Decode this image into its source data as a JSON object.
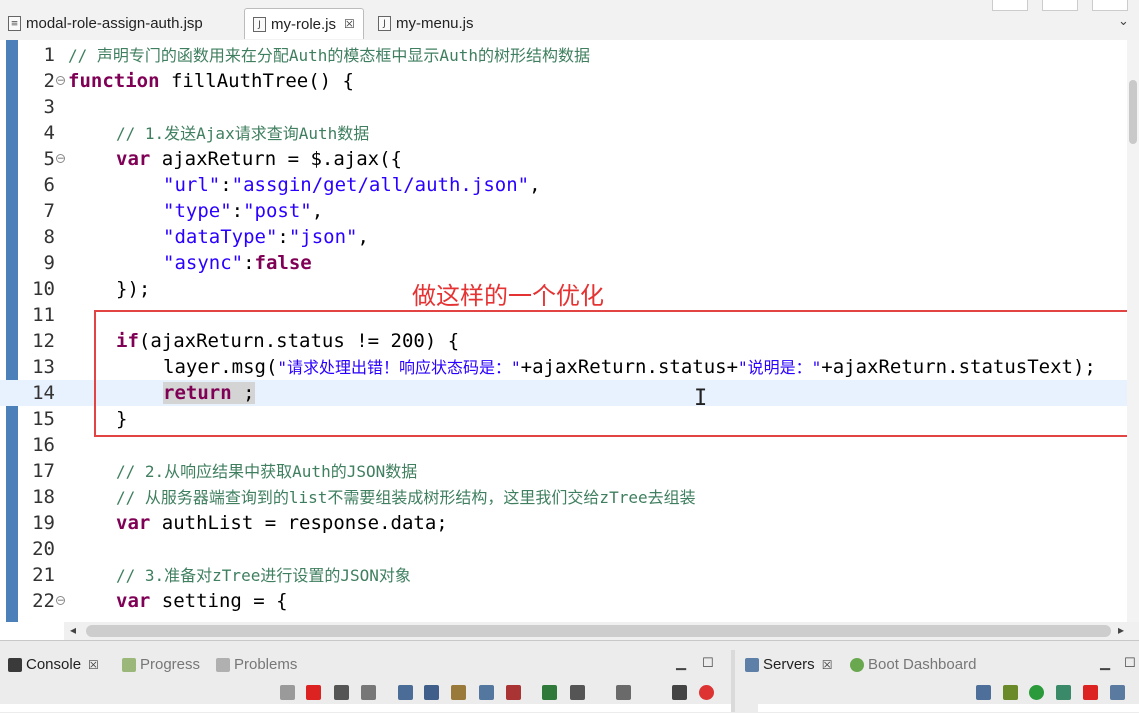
{
  "tabs": [
    {
      "label": "modal-role-assign-auth.jsp",
      "active": false
    },
    {
      "label": "my-role.js",
      "active": true,
      "close": "☒"
    },
    {
      "label": "my-menu.js",
      "active": false
    }
  ],
  "editor": {
    "lines": [
      {
        "n": "1"
      },
      {
        "n": "2"
      },
      {
        "n": "3"
      },
      {
        "n": "4"
      },
      {
        "n": "5"
      },
      {
        "n": "6"
      },
      {
        "n": "7"
      },
      {
        "n": "8"
      },
      {
        "n": "9"
      },
      {
        "n": "10"
      },
      {
        "n": "11"
      },
      {
        "n": "12"
      },
      {
        "n": "13"
      },
      {
        "n": "14"
      },
      {
        "n": "15"
      },
      {
        "n": "16"
      },
      {
        "n": "17"
      },
      {
        "n": "18"
      },
      {
        "n": "19"
      },
      {
        "n": "20"
      },
      {
        "n": "21"
      },
      {
        "n": "22"
      }
    ],
    "c1": "// 声明专门的函数用来在分配Auth的模态框中显示Auth的树形结构数据",
    "l2_kw": "function",
    "l2_rest": " fillAuthTree() {",
    "c4": "// 1.发送Ajax请求查询Auth数据",
    "l5_kw": "var",
    "l5_rest": " ajaxReturn = $.ajax({",
    "l6_a": "\"url\"",
    "l6_b": ":",
    "l6_c": "\"assgin/get/all/auth.json\"",
    "l6_d": ",",
    "l7_a": "\"type\"",
    "l7_b": ":",
    "l7_c": "\"post\"",
    "l7_d": ",",
    "l8_a": "\"dataType\"",
    "l8_b": ":",
    "l8_c": "\"json\"",
    "l8_d": ",",
    "l9_a": "\"async\"",
    "l9_b": ":",
    "l9_c": "false",
    "l10": "});",
    "l12_kw": "if",
    "l12_rest": "(ajaxReturn.status != 200) {",
    "l13_a": "layer.msg(",
    "l13_b": "\"请求处理出错！响应状态码是：\"",
    "l13_c": "+ajaxReturn.status+",
    "l13_d": "\"说明是：\"",
    "l13_e": "+ajaxReturn.statusText);",
    "l14_kw": "return",
    "l14_rest": " ;",
    "l15": "}",
    "c17": "// 2.从响应结果中获取Auth的JSON数据",
    "c18": "// 从服务器端查询到的list不需要组装成树形结构，这里我们交给zTree去组装",
    "l19_kw": "var",
    "l19_rest": " authList = response.data;",
    "c21": "// 3.准备对zTree进行设置的JSON对象",
    "l22_kw": "var",
    "l22_rest": " setting = {",
    "annotation": "做这样的一个优化"
  },
  "panels": {
    "console": "Console",
    "progress": "Progress",
    "problems": "Problems",
    "servers": "Servers",
    "boot_dashboard": "Boot Dashboard"
  },
  "colors": {
    "keyword": "#7f0055",
    "string": "#2a00ff",
    "comment": "#3f7f5f",
    "annotation": "#e53333",
    "highlight_line": "#e8f2fe"
  }
}
